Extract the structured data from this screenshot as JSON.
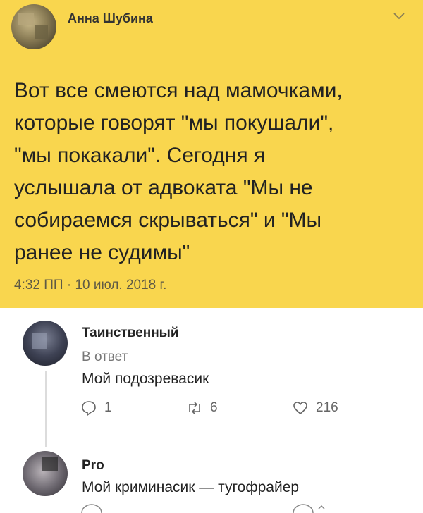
{
  "main_tweet": {
    "author": "Анна Шубина",
    "text": "Вот все смеются над мамочками,\nкоторые говорят \"мы покушали\",\n\"мы покакали\". Сегодня я\nуслышала от адвоката \"Мы не\nсобираемся скрываться\" и \"Мы\nранее не судимы\"",
    "timestamp": "4:32 ПП · 10 июл. 2018 г."
  },
  "replies": [
    {
      "author": "Таинственный",
      "reply_to": "В ответ",
      "text": "Мой подозревасик",
      "actions": {
        "reply_count": "1",
        "retweet_count": "6",
        "like_count": "216"
      }
    },
    {
      "author": "Pro",
      "text": "Мой криминасик — тугофрайер"
    }
  ],
  "colors": {
    "tweet_background": "#f9d64e",
    "page_background": "#ffffff"
  },
  "icons": {
    "chevron": "chevron-down-icon",
    "reply": "reply-icon",
    "retweet": "retweet-icon",
    "like": "heart-icon"
  }
}
